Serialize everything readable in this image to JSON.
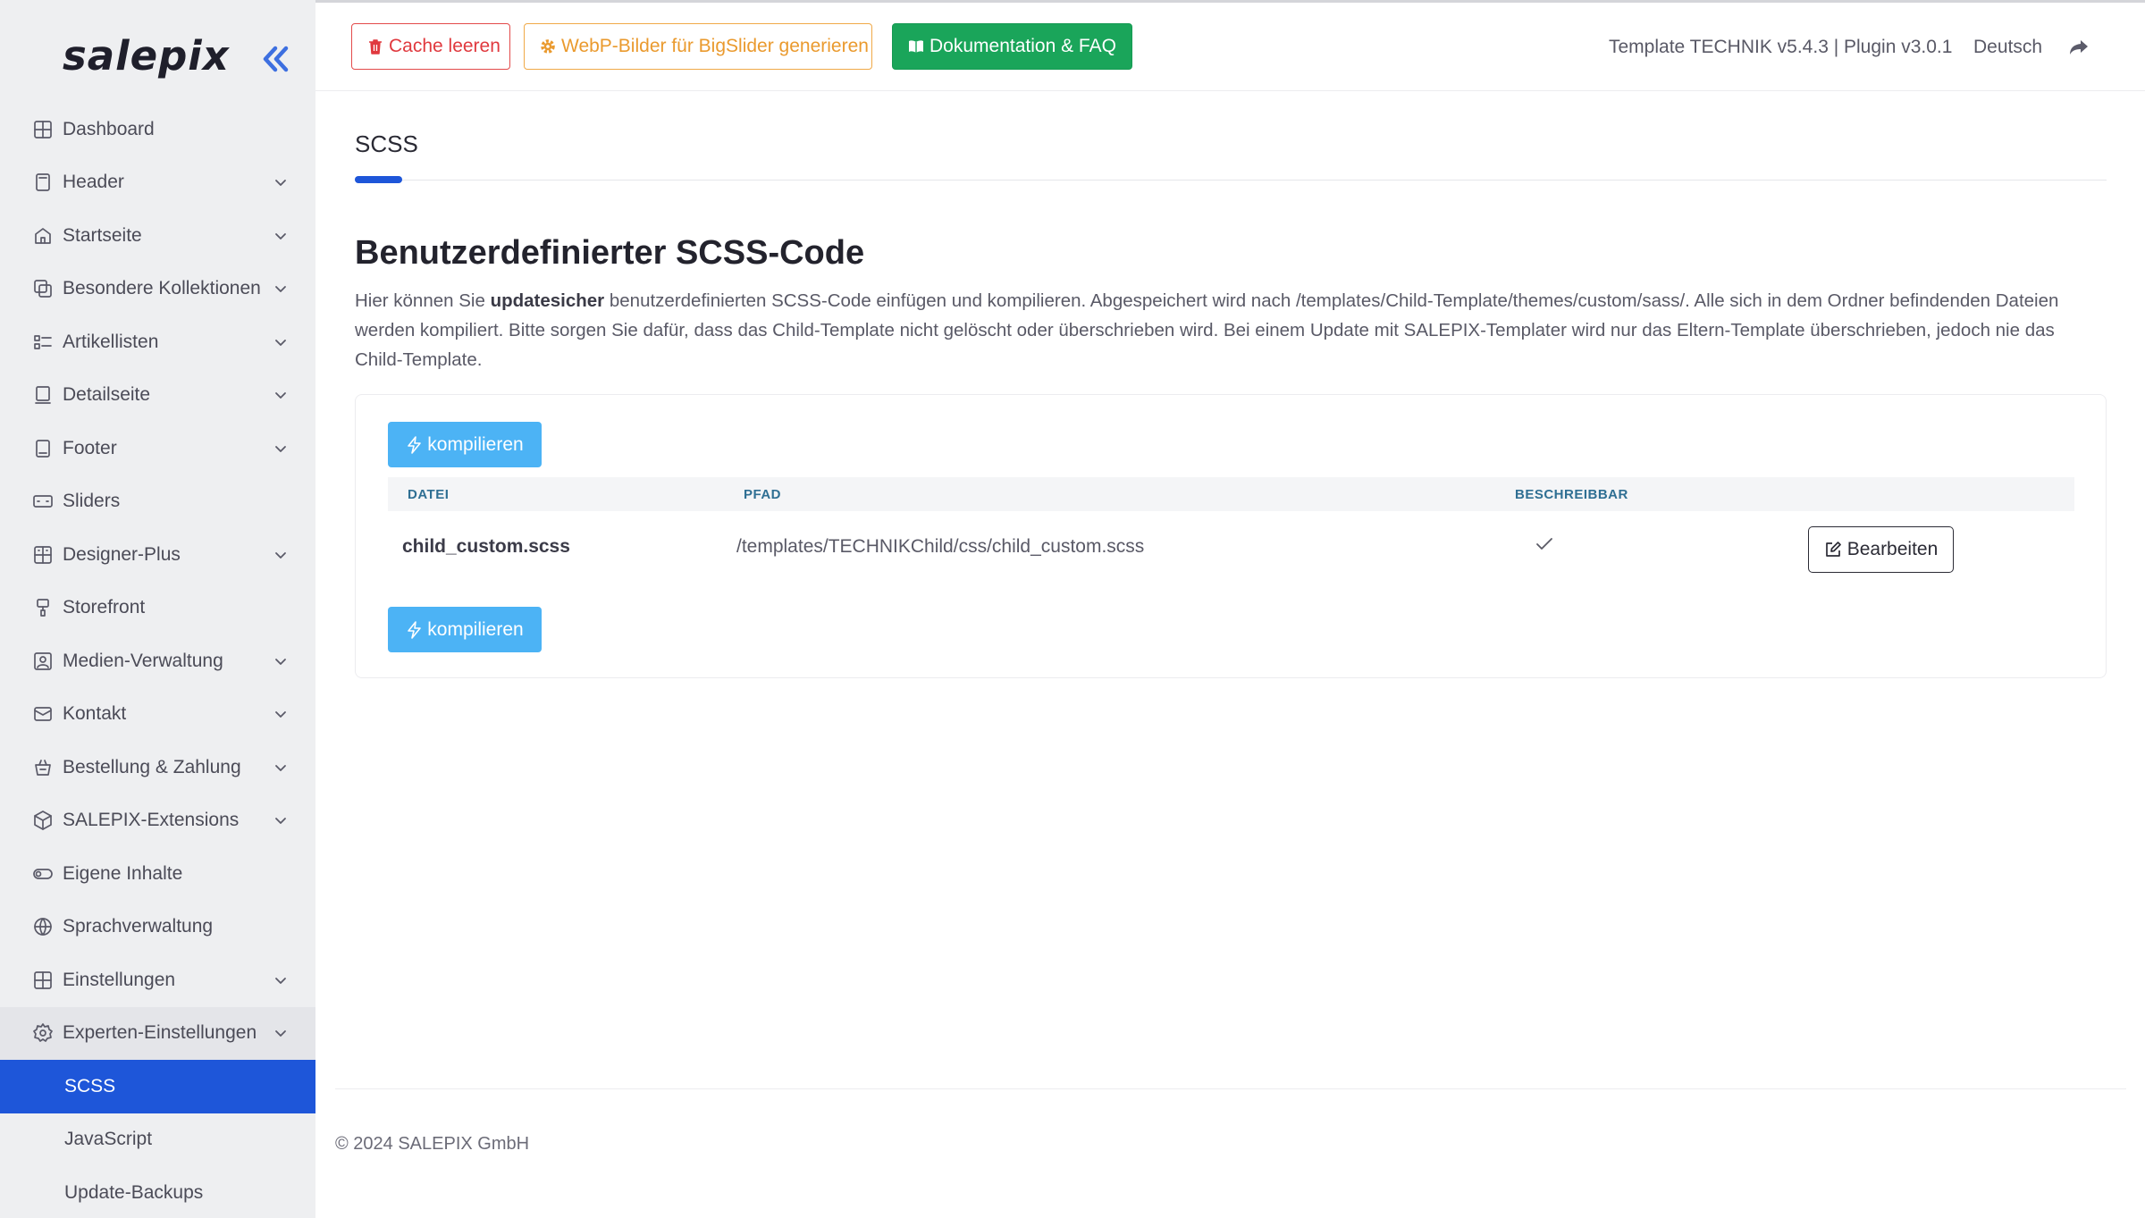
{
  "brand": "salepix",
  "colors": {
    "accent": "#1e56d9",
    "danger": "#e0393e",
    "warning": "#ea9a2e",
    "success": "#1aa55a",
    "info": "#4cb3f5"
  },
  "sidebar": {
    "items": [
      {
        "label": "Dashboard",
        "icon": "dashboard-icon",
        "has_children": false
      },
      {
        "label": "Header",
        "icon": "header-icon",
        "has_children": true
      },
      {
        "label": "Startseite",
        "icon": "home-icon",
        "has_children": true
      },
      {
        "label": "Besondere Kollektionen",
        "icon": "collections-icon",
        "has_children": true
      },
      {
        "label": "Artikellisten",
        "icon": "list-icon",
        "has_children": true
      },
      {
        "label": "Detailseite",
        "icon": "detail-page-icon",
        "has_children": true
      },
      {
        "label": "Footer",
        "icon": "footer-icon",
        "has_children": true
      },
      {
        "label": "Sliders",
        "icon": "slider-icon",
        "has_children": false
      },
      {
        "label": "Designer-Plus",
        "icon": "designer-icon",
        "has_children": true
      },
      {
        "label": "Storefront",
        "icon": "brush-icon",
        "has_children": false
      },
      {
        "label": "Medien-Verwaltung",
        "icon": "media-icon",
        "has_children": true
      },
      {
        "label": "Kontakt",
        "icon": "mail-icon",
        "has_children": true
      },
      {
        "label": "Bestellung & Zahlung",
        "icon": "basket-icon",
        "has_children": true
      },
      {
        "label": "SALEPIX-Extensions",
        "icon": "package-icon",
        "has_children": true
      },
      {
        "label": "Eigene Inhalte",
        "icon": "toggle-icon",
        "has_children": false
      },
      {
        "label": "Sprachverwaltung",
        "icon": "globe-icon",
        "has_children": false
      },
      {
        "label": "Einstellungen",
        "icon": "settings-grid-icon",
        "has_children": true
      },
      {
        "label": "Experten-Einstellungen",
        "icon": "gear-icon",
        "has_children": true
      }
    ],
    "sub_items": [
      {
        "label": "SCSS",
        "active": true
      },
      {
        "label": "JavaScript",
        "active": false
      },
      {
        "label": "Update-Backups",
        "active": false
      }
    ]
  },
  "topbar": {
    "cache_label": "Cache leeren",
    "webp_label": "WebP-Bilder für BigSlider generieren",
    "docs_label": "Dokumentation & FAQ",
    "version": "Template TECHNIK v5.4.3 | Plugin v3.0.1",
    "language": "Deutsch"
  },
  "main": {
    "tab": "SCSS",
    "title": "Benutzerdefinierter SCSS-Code",
    "description_pre": "Hier können Sie ",
    "description_bold": "updatesicher",
    "description_post": " benutzerdefinierten SCSS-Code einfügen und kompilieren. Abgespeichert wird nach /templates/Child-Template/themes/custom/sass/. Alle sich in dem Ordner befindenden Dateien werden kompiliert. Bitte sorgen Sie dafür, dass das Child-Template nicht gelöscht oder überschrieben wird. Bei einem Update mit SALEPIX-Templater wird nur das Eltern-Template überschrieben, jedoch nie das Child-Template.",
    "compile_label": "kompilieren",
    "table": {
      "headers": [
        "DATEI",
        "PFAD",
        "BESCHREIBBAR"
      ],
      "rows": [
        {
          "file": "child_custom.scss",
          "path": "/templates/TECHNIKChild/css/child_custom.scss",
          "writable": true,
          "edit_label": "Bearbeiten"
        }
      ]
    }
  },
  "footer": {
    "copyright": "© 2024 SALEPIX GmbH"
  }
}
